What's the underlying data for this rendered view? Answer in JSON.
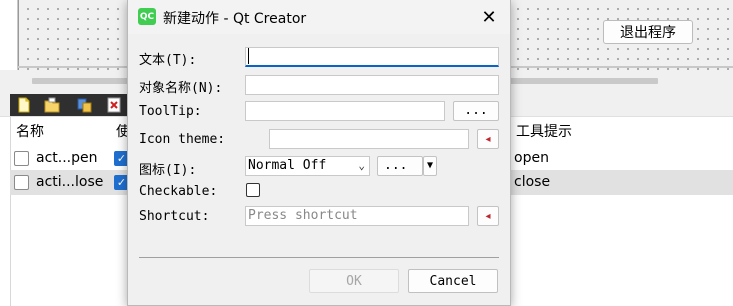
{
  "background": {
    "quit_button_label": "退出程序",
    "table": {
      "headers": [
        "名称",
        "使",
        "工具提示"
      ],
      "rows": [
        {
          "name": "act...pen",
          "used": true,
          "tooltip": "open"
        },
        {
          "name": "acti...lose",
          "used": true,
          "tooltip": "close"
        }
      ]
    }
  },
  "dialog": {
    "title": "新建动作 - Qt Creator",
    "app_icon_text": "QC",
    "close_glyph": "✕",
    "labels": {
      "text": "文本(T):",
      "object_name": "对象名称(N):",
      "tooltip": "ToolTip:",
      "icon_theme": "Icon theme:",
      "icon": "图标(I):",
      "checkable": "Checkable:",
      "shortcut": "Shortcut:"
    },
    "values": {
      "text": "",
      "object_name": "",
      "tooltip": "",
      "icon_theme": "",
      "icon_mode": "Normal Off",
      "checkable": false,
      "shortcut_placeholder": "Press shortcut"
    },
    "ellipsis_label": "...",
    "ok_label": "OK",
    "cancel_label": "Cancel"
  },
  "colors": {
    "accent": "#0a64c8",
    "checkbox_checked": "#1f6fd0",
    "qt_green": "#41cd52",
    "reset_red": "#c0262e"
  }
}
